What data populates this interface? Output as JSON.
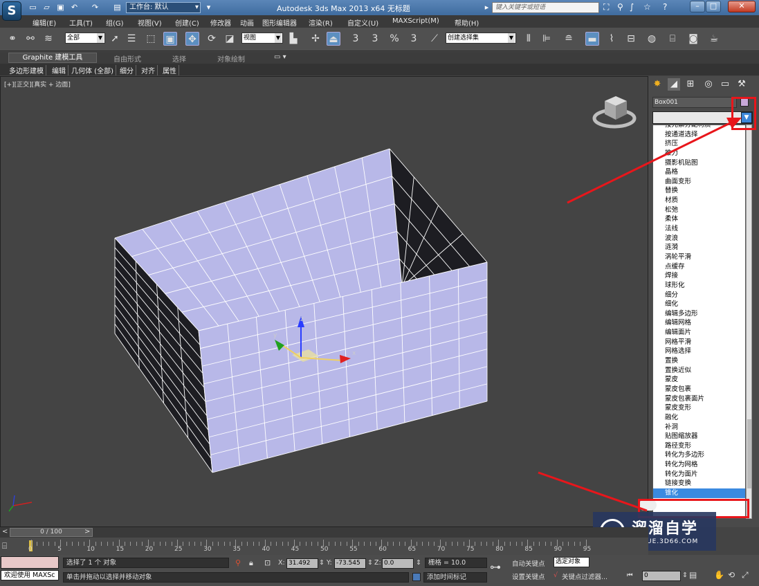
{
  "title_bar": {
    "app_logo": "S",
    "workspace_value": "工作台: 默认",
    "title": "Autodesk 3ds Max  2013 x64     无标题",
    "search_placeholder": "键入关键字或短语",
    "help_label": "?",
    "bg_color": "#4a77a8"
  },
  "menu": [
    "编辑(E)",
    "工具(T)",
    "组(G)",
    "视图(V)",
    "创建(C)",
    "修改器",
    "动画",
    "图形编辑器",
    "渲染(R)",
    "自定义(U)",
    "MAXScript(M)",
    "帮助(H)"
  ],
  "toolbar": {
    "filter_value": "全部",
    "refcoord_value": "视图",
    "selection_set_value": "创建选择集",
    "snap_labels": [
      "3",
      "3",
      "%",
      "3"
    ]
  },
  "ribbon": {
    "tabs": [
      "Graphite 建模工具",
      "自由形式",
      "选择",
      "对象绘制"
    ],
    "subtabs": [
      "多边形建模",
      "编辑",
      "几何体 (全部)",
      "细分",
      "对齐",
      "属性"
    ]
  },
  "viewport": {
    "label": "[+][正交][真实 + 边面]",
    "axis_labels": {
      "x": "x",
      "y": "y",
      "z": "z"
    },
    "box_color": "#b8b8e8",
    "inner_color": "#1d1d22"
  },
  "command_panel": {
    "object_name": "Box001",
    "object_color": "#c8a8d8",
    "modifier_list": [
      "按元素分配材质",
      "按通道选择",
      "挤压",
      "推力",
      "摄影机贴图",
      "晶格",
      "曲面变形",
      "替换",
      "材质",
      "松弛",
      "柔体",
      "法线",
      "波浪",
      "涟漪",
      "涡轮平滑",
      "点缓存",
      "焊接",
      "球形化",
      "细分",
      "细化",
      "编辑多边形",
      "编辑网格",
      "编辑面片",
      "网格平滑",
      "网格选择",
      "置换",
      "置换近似",
      "蒙皮",
      "蒙皮包裹",
      "蒙皮包裹面片",
      "蒙皮变形",
      "融化",
      "补洞",
      "贴图缩放器",
      "路径变形",
      "转化为多边形",
      "转化为网格",
      "转化为面片",
      "链接变换",
      "锥化"
    ],
    "selected_index": 39,
    "highlight_color": "#3b8ae0"
  },
  "annotation_color": "#e8161b",
  "watermark": {
    "logo": "▷",
    "title": "溜溜自学",
    "subtitle": "ZIXUE.3D66.COM"
  },
  "timeline": {
    "frame_label": "0 / 100",
    "ticks": [
      "0",
      "5",
      "10",
      "15",
      "20",
      "25",
      "30",
      "35",
      "40",
      "45",
      "50",
      "55",
      "60",
      "65",
      "70",
      "75",
      "80",
      "85",
      "90",
      "95"
    ]
  },
  "status": {
    "welcome": "欢迎使用 MAXSc",
    "selection": "选择了 1 个 对象",
    "prompt": "单击并拖动以选择并移动对象",
    "x_label": "X:",
    "x_value": "31.492",
    "y_label": "Y:",
    "y_value": "-73.545",
    "z_label": "Z:",
    "z_value": "0.0",
    "grid": "栅格 = 10.0",
    "add_time_tag": "添加时间标记",
    "auto_key": "自动关键点",
    "selected_mode": "选定对象",
    "set_key": "设置关键点",
    "key_filters": "关键点过滤器...",
    "frame_value": "0"
  }
}
